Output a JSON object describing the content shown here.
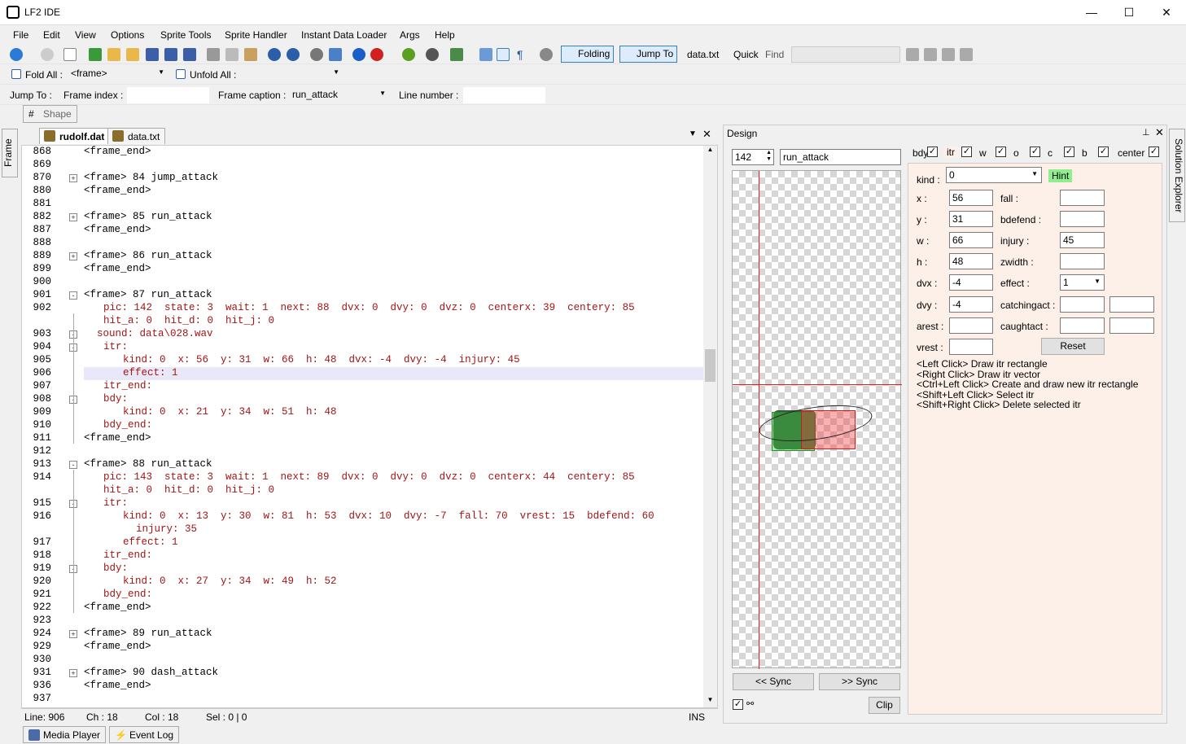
{
  "window": {
    "title": "LF2 IDE",
    "min": "—",
    "max": "☐",
    "close": "✕"
  },
  "menu": [
    "File",
    "Edit",
    "View",
    "Options",
    "Sprite Tools",
    "Sprite Handler",
    "Instant Data Loader",
    "Args",
    "Help"
  ],
  "toolbar": {
    "folding": "Folding",
    "jump_to": "Jump To",
    "file": "data.txt",
    "quick": "Quick",
    "find": "Find"
  },
  "foldbar": {
    "fold_all": "Fold All :",
    "fold_value": "<frame>",
    "unfold_all": "Unfold All :",
    "unfold_value": ""
  },
  "jumpbar": {
    "jump_to": "Jump To :",
    "frame_index": "Frame index :",
    "frame_caption": "Frame caption :",
    "caption_value": "run_attack",
    "line_number": "Line number :"
  },
  "shape_tab": {
    "hash": "#",
    "label": "Shape"
  },
  "left_side_tab": "Frame",
  "right_side_tab": "Solution Explorer",
  "editor_tabs": [
    {
      "label": "rudolf.dat",
      "active": true
    },
    {
      "label": "data.txt",
      "active": false
    }
  ],
  "editor_lines": [
    {
      "n": "868",
      "t": "<frame_end>",
      "ind": 0
    },
    {
      "n": "869",
      "t": "",
      "ind": 0
    },
    {
      "n": "870",
      "t": "<frame> 84 jump_attack",
      "ind": 0,
      "fold": "+"
    },
    {
      "n": "880",
      "t": "<frame_end>",
      "ind": 0
    },
    {
      "n": "881",
      "t": "",
      "ind": 0
    },
    {
      "n": "882",
      "t": "<frame> 85 run_attack",
      "ind": 0,
      "fold": "+"
    },
    {
      "n": "887",
      "t": "<frame_end>",
      "ind": 0
    },
    {
      "n": "888",
      "t": "",
      "ind": 0
    },
    {
      "n": "889",
      "t": "<frame> 86 run_attack",
      "ind": 0,
      "fold": "+"
    },
    {
      "n": "899",
      "t": "<frame_end>",
      "ind": 0
    },
    {
      "n": "900",
      "t": "",
      "ind": 0
    },
    {
      "n": "901",
      "t": "<frame> 87 run_attack",
      "ind": 0,
      "fold": "-"
    },
    {
      "n": "902",
      "t": "pic: 142  state: 3  wait: 1  next: 88  dvx: 0  dvy: 0  dvz: 0  centerx: 39  centery: 85",
      "ind": 1
    },
    {
      "n": "",
      "t": "hit_a: 0  hit_d: 0  hit_j: 0",
      "ind": 1
    },
    {
      "n": "903",
      "t": "sound: data\\028.wav",
      "ind": 1,
      "fold": "-",
      "shift": -1
    },
    {
      "n": "904",
      "t": "itr:",
      "ind": 1,
      "fold": "-"
    },
    {
      "n": "905",
      "t": "kind: 0  x: 56  y: 31  w: 66  h: 48  dvx: -4  dvy: -4  injury: 45",
      "ind": 2
    },
    {
      "n": "906",
      "t": "effect: 1",
      "ind": 2,
      "hl": true
    },
    {
      "n": "907",
      "t": "itr_end:",
      "ind": 1
    },
    {
      "n": "908",
      "t": "bdy:",
      "ind": 1,
      "fold": "-"
    },
    {
      "n": "909",
      "t": "kind: 0  x: 21  y: 34  w: 51  h: 48",
      "ind": 2
    },
    {
      "n": "910",
      "t": "bdy_end:",
      "ind": 1
    },
    {
      "n": "911",
      "t": "<frame_end>",
      "ind": 0
    },
    {
      "n": "912",
      "t": "",
      "ind": 0
    },
    {
      "n": "913",
      "t": "<frame> 88 run_attack",
      "ind": 0,
      "fold": "-"
    },
    {
      "n": "914",
      "t": "pic: 143  state: 3  wait: 1  next: 89  dvx: 0  dvy: 0  dvz: 0  centerx: 44  centery: 85",
      "ind": 1
    },
    {
      "n": "",
      "t": "hit_a: 0  hit_d: 0  hit_j: 0",
      "ind": 1
    },
    {
      "n": "915",
      "t": "itr:",
      "ind": 1,
      "fold": "-"
    },
    {
      "n": "916",
      "t": "kind: 0  x: 13  y: 30  w: 81  h: 53  dvx: 10  dvy: -7  fall: 70  vrest: 15  bdefend: 60",
      "ind": 2
    },
    {
      "n": "",
      "t": "injury: 35",
      "ind": 3
    },
    {
      "n": "917",
      "t": "effect: 1",
      "ind": 2
    },
    {
      "n": "918",
      "t": "itr_end:",
      "ind": 1
    },
    {
      "n": "919",
      "t": "bdy:",
      "ind": 1,
      "fold": "-"
    },
    {
      "n": "920",
      "t": "kind: 0  x: 27  y: 34  w: 49  h: 52",
      "ind": 2
    },
    {
      "n": "921",
      "t": "bdy_end:",
      "ind": 1
    },
    {
      "n": "922",
      "t": "<frame_end>",
      "ind": 0
    },
    {
      "n": "923",
      "t": "",
      "ind": 0
    },
    {
      "n": "924",
      "t": "<frame> 89 run_attack",
      "ind": 0,
      "fold": "+"
    },
    {
      "n": "929",
      "t": "<frame_end>",
      "ind": 0
    },
    {
      "n": "930",
      "t": "",
      "ind": 0
    },
    {
      "n": "931",
      "t": "<frame> 90 dash_attack",
      "ind": 0,
      "fold": "+"
    },
    {
      "n": "936",
      "t": "<frame_end>",
      "ind": 0
    },
    {
      "n": "937",
      "t": "",
      "ind": 0
    }
  ],
  "status": {
    "line": "Line:  906",
    "ch": "Ch :  18",
    "col": "Col :  18",
    "sel": "Sel :  0 | 0",
    "mode": "INS"
  },
  "design": {
    "title": "Design",
    "frame_num": "142",
    "frame_caption": "run_attack",
    "sync_back": "<< Sync",
    "sync_fwd": ">> Sync",
    "clip": "Clip",
    "tabs": [
      {
        "label": "bdy",
        "checked": true
      },
      {
        "label": "itr",
        "checked": true
      },
      {
        "label": "w",
        "checked": true
      },
      {
        "label": "o",
        "checked": true
      },
      {
        "label": "c",
        "checked": true
      },
      {
        "label": "b",
        "checked": true
      },
      {
        "label": "center",
        "checked": true
      }
    ],
    "kind_label": "kind :",
    "kind_value": "0",
    "hint": "Hint",
    "fields": [
      {
        "l": "x :",
        "v": "56",
        "r": "fall :",
        "rv": ""
      },
      {
        "l": "y :",
        "v": "31",
        "r": "bdefend :",
        "rv": ""
      },
      {
        "l": "w :",
        "v": "66",
        "r": "injury :",
        "rv": "45"
      },
      {
        "l": "h :",
        "v": "48",
        "r": "zwidth :",
        "rv": ""
      },
      {
        "l": "dvx :",
        "v": "-4",
        "r": "effect :",
        "rv": "1"
      },
      {
        "l": "dvy :",
        "v": "-4",
        "r": "catchingact :",
        "rv": ""
      },
      {
        "l": "arest :",
        "v": "",
        "r": "caughtact :",
        "rv": ""
      },
      {
        "l": "vrest :",
        "v": "",
        "r": "",
        "rv": ""
      }
    ],
    "reset": "Reset",
    "hints": [
      "<Left Click> Draw itr rectangle",
      "<Right Click> Draw itr vector",
      "<Ctrl+Left Click> Create and draw new itr rectangle",
      "<Shift+Left Click> Select itr",
      "<Shift+Right Click> Delete selected itr"
    ]
  },
  "bottom_tabs": [
    "Media Player",
    "Event Log"
  ],
  "colors": {
    "accent": "#0078d7",
    "keyword": "#a31515",
    "highlight": "#e8e8f8",
    "panel_bg": "#fdf0e8"
  }
}
